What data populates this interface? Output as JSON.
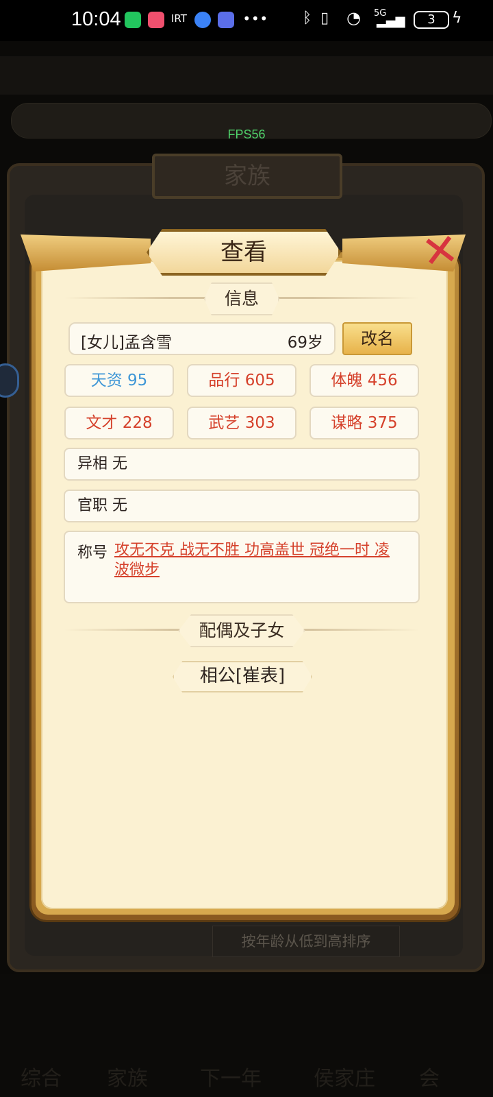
{
  "status_bar": {
    "time": "10:04",
    "carrier_text": "∙∙∙",
    "network": "5G",
    "battery": "3",
    "app_label_small": "IRT"
  },
  "fps": "FPS56",
  "background": {
    "panel_title": "家族",
    "sort_button": "按年龄从低到高排序",
    "bottom_tabs": [
      "综合",
      "家族",
      "下一年",
      "侯家庄",
      "会"
    ]
  },
  "dialog": {
    "title": "查看",
    "section_info": "信息",
    "name": "[女儿]孟含雪",
    "age": "69岁",
    "rename_button": "改名",
    "stats": [
      {
        "label": "天资 95",
        "color": "#3e96d6"
      },
      {
        "label": "品行 605",
        "color": "#d5412b"
      },
      {
        "label": "体魄 456",
        "color": "#d5412b"
      },
      {
        "label": "文才 228",
        "color": "#d5412b"
      },
      {
        "label": "武艺 303",
        "color": "#d5412b"
      },
      {
        "label": "谋略 375",
        "color": "#d5412b"
      }
    ],
    "appearance": "异相 无",
    "official_post": "官职 无",
    "honor_label": "称号",
    "honor_value": "攻无不克 战无不胜 功高盖世 冠绝一时 凌波微步",
    "section_family": "配偶及子女",
    "spouse": "相公[崔表]"
  }
}
